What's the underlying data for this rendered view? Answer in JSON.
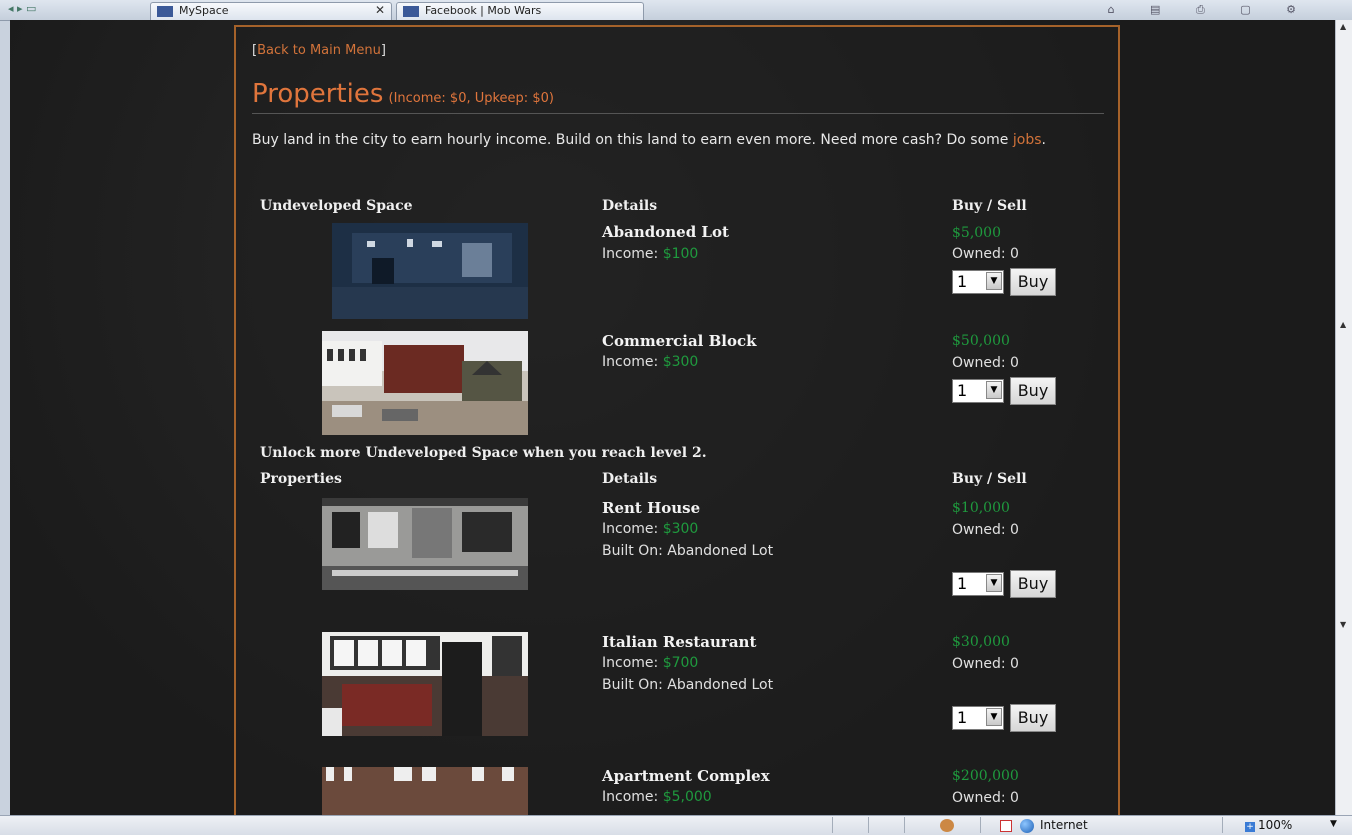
{
  "browser": {
    "tabs": [
      {
        "label": "MySpace"
      },
      {
        "label": "Facebook | Mob Wars"
      }
    ]
  },
  "page": {
    "back_bracket_open": "[",
    "back_link": "Back to Main Menu",
    "back_bracket_close": "]",
    "title": "Properties",
    "subtitle": "(Income: $0, Upkeep: $0)",
    "intro_text": "Buy land in the city to earn hourly income. Build on this land to earn even more. Need more cash? Do some ",
    "intro_link": "jobs",
    "intro_end": "."
  },
  "undeveloped": {
    "col_space": "Undeveloped Space",
    "col_details": "Details",
    "col_buysell": "Buy / Sell",
    "items": [
      {
        "name": "Abandoned Lot",
        "income_label": "Income: ",
        "income": "$100",
        "price": "$5,000",
        "owned": "Owned: 0",
        "qty": "1",
        "buy": "Buy"
      },
      {
        "name": "Commercial Block",
        "income_label": "Income: ",
        "income": "$300",
        "price": "$50,000",
        "owned": "Owned: 0",
        "qty": "1",
        "buy": "Buy"
      }
    ],
    "unlock_text": "Unlock more Undeveloped Space when you reach level 2."
  },
  "properties": {
    "col_space": "Properties",
    "col_details": "Details",
    "col_buysell": "Buy / Sell",
    "items": [
      {
        "name": "Rent House",
        "income_label": "Income: ",
        "income": "$300",
        "built_on": "Built On: Abandoned Lot",
        "price": "$10,000",
        "owned": "Owned: 0",
        "qty": "1",
        "buy": "Buy"
      },
      {
        "name": "Italian Restaurant",
        "income_label": "Income: ",
        "income": "$700",
        "built_on": "Built On: Abandoned Lot",
        "price": "$30,000",
        "owned": "Owned: 0",
        "qty": "1",
        "buy": "Buy"
      },
      {
        "name": "Apartment Complex",
        "income_label": "Income: ",
        "income": "$5,000",
        "price": "$200,000",
        "owned": "Owned: 0"
      }
    ]
  },
  "statusbar": {
    "zone": "Internet",
    "zoom": "100%"
  }
}
